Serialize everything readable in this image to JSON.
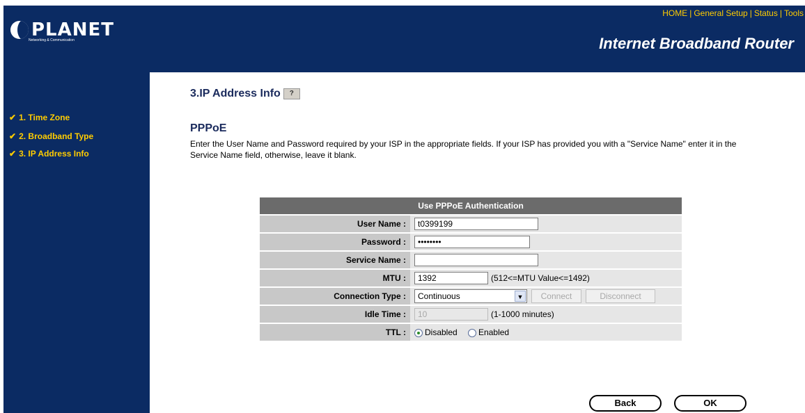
{
  "brand": {
    "name": "PLANET",
    "tagline": "Networking & Communication"
  },
  "top_nav": {
    "home": "HOME",
    "general_setup": "General Setup",
    "status": "Status",
    "tools": "Tools",
    "separator": "|"
  },
  "product_title": "Internet Broadband Router",
  "sidebar": {
    "items": [
      {
        "label": "1. Time Zone"
      },
      {
        "label": "2. Broadband Type"
      },
      {
        "label": "3. IP Address Info"
      }
    ]
  },
  "page": {
    "title": "3.IP Address Info",
    "section_title": "PPPoE",
    "description": "Enter the User Name and Password required by your ISP in the appropriate fields. If your ISP has provided you with a \"Service Name\" enter it in the Service Name field, otherwise, leave it blank."
  },
  "form": {
    "header": "Use PPPoE Authentication",
    "user_name": {
      "label": "User Name :",
      "value": "t0399199"
    },
    "password": {
      "label": "Password :",
      "value": "12345678"
    },
    "service_name": {
      "label": "Service Name :",
      "value": ""
    },
    "mtu": {
      "label": "MTU :",
      "value": "1392",
      "hint": "(512<=MTU Value<=1492)"
    },
    "connection_type": {
      "label": "Connection Type :",
      "selected": "Continuous",
      "connect": "Connect",
      "disconnect": "Disconnect"
    },
    "idle_time": {
      "label": "Idle Time :",
      "value": "10",
      "hint": "(1-1000 minutes)"
    },
    "ttl": {
      "label": "TTL :",
      "options": [
        "Disabled",
        "Enabled"
      ],
      "selected": "Disabled"
    }
  },
  "buttons": {
    "back": "Back",
    "ok": "OK"
  },
  "colors": {
    "header_bg": "#0b2b63",
    "accent": "#ffcc00",
    "table_header": "#6b6b6b"
  }
}
